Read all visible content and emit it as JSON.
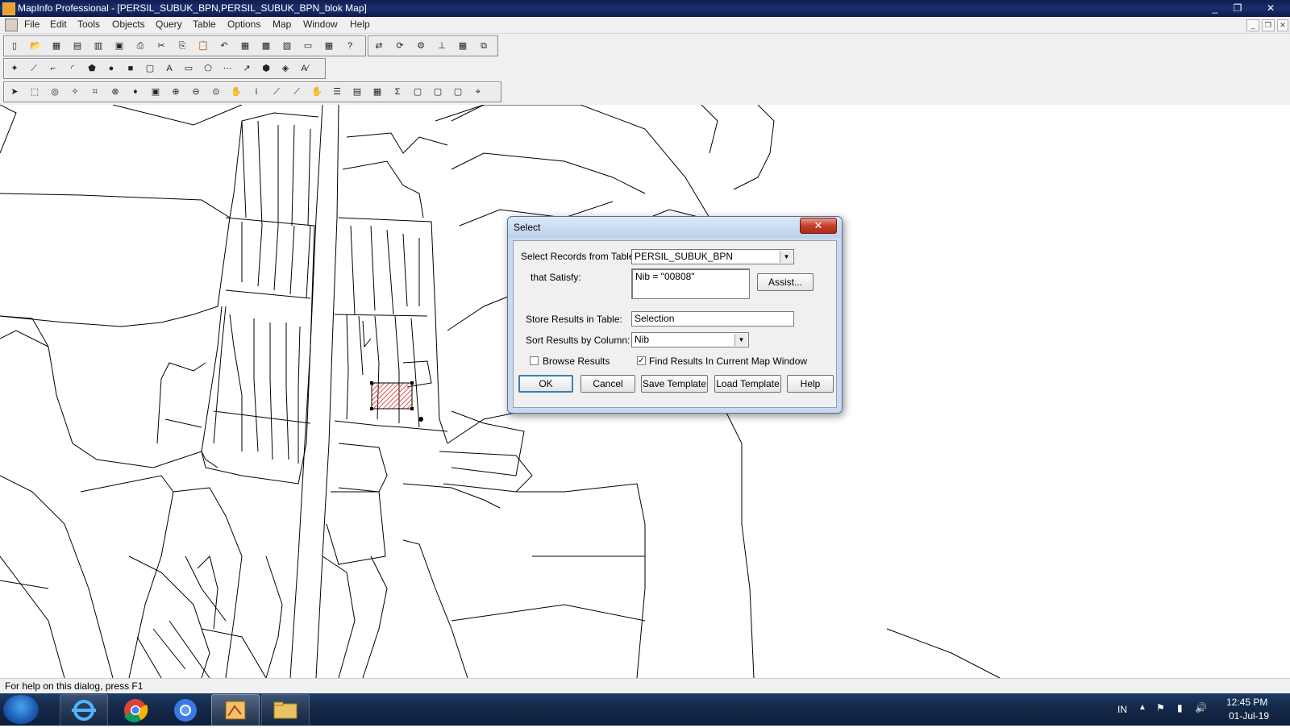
{
  "window": {
    "title": "MapInfo Professional - [PERSIL_SUBUK_BPN,PERSIL_SUBUK_BPN_blok Map]",
    "controls": [
      "_",
      "❐",
      "✕"
    ]
  },
  "menu": {
    "items": [
      "File",
      "Edit",
      "Tools",
      "Objects",
      "Query",
      "Table",
      "Options",
      "Map",
      "Window",
      "Help"
    ],
    "mdi_controls": [
      "_",
      "❐",
      "✕"
    ]
  },
  "toolbars": {
    "standard": [
      "new-icon",
      "open-icon",
      "open-workspace-icon",
      "save-icon",
      "save-workspace-icon",
      "print-preview-icon",
      "print-icon",
      "cut-icon",
      "copy-icon",
      "paste-icon",
      "undo-icon",
      "new-browser-icon",
      "new-mapper-icon",
      "new-grapher-icon",
      "new-layout-icon",
      "redistrict-icon",
      "help-icon"
    ],
    "standard_tail": [
      "hotlink-icon",
      "run-mapbasic-icon",
      "tool-manager-icon",
      "statistics-icon",
      "color-icon",
      "window-icon"
    ],
    "drawing": [
      "symbol-icon",
      "line-icon",
      "polyline-icon",
      "arc-icon",
      "polygon-icon",
      "ellipse-icon",
      "rectangle-icon",
      "rounded-rect-icon",
      "text-icon",
      "frame-icon",
      "reshape-icon",
      "add-node-icon",
      "line-style-icon",
      "region-style-icon",
      "symbol-style-icon",
      "text-style-icon"
    ],
    "main": [
      "select-icon",
      "marquee-select-icon",
      "radius-select-icon",
      "polygon-select-icon",
      "boundary-select-icon",
      "unselect-all-icon",
      "invert-selection-icon",
      "graph-select-icon",
      "zoom-in-icon",
      "zoom-out-icon",
      "change-view-icon",
      "grabber-icon",
      "info-icon",
      "hotlink-tool-icon",
      "ruler-icon",
      "drag-map-icon",
      "layer-control-icon",
      "label-icon",
      "legend-icon",
      "statistics-sum-icon",
      "clip-region-icon",
      "set-clip-icon",
      "drag-window-icon",
      "layout-tool-icon"
    ],
    "drawing_glyphs": [
      "✦",
      "⟋",
      "⌐",
      "◜",
      "⬟",
      "●",
      "■",
      "▢",
      "A",
      "▭",
      "⬠",
      "⋯",
      "↗",
      "⬢",
      "◈",
      "A⁄"
    ],
    "main_glyphs": [
      "➤",
      "⬚",
      "◎",
      "✧",
      "⌗",
      "⊗",
      "➧",
      "▣",
      "⊕",
      "⊖",
      "⊙",
      "✋",
      "i",
      "⟋",
      "⟋",
      "✋",
      "☰",
      "▤",
      "▦",
      "Σ",
      "▢",
      "▢",
      "▢",
      "⌖"
    ],
    "standard_glyphs": [
      "▯",
      "📂",
      "▦",
      "▤",
      "▥",
      "▣",
      "⎙",
      "✂",
      "⎘",
      "📋",
      "↶",
      "▦",
      "▩",
      "▧",
      "▭",
      "▦",
      "?"
    ],
    "standard_tail_glyphs": [
      "⇄",
      "⟳",
      "⚙",
      "⊥",
      "▦",
      "⧉"
    ]
  },
  "status_bar": {
    "text": "For help on this dialog, press F1"
  },
  "dialog": {
    "title": "Select",
    "close_label": "✕",
    "select_records_label": "Select Records from Table:",
    "table_value": "PERSIL_SUBUK_BPN",
    "that_satisfy_label": "that Satisfy:",
    "expression_value": "Nib = \"00808\"",
    "assist_label": "Assist...",
    "store_results_label": "Store Results in Table:",
    "store_value": "Selection",
    "sort_results_label": "Sort Results by Column:",
    "sort_value": "Nib",
    "browse_results_label": "Browse Results",
    "browse_results_checked": false,
    "find_results_label": "Find Results In Current Map Window",
    "find_results_checked": true,
    "buttons": {
      "ok": "OK",
      "cancel": "Cancel",
      "save_template": "Save Template",
      "load_template": "Load Template",
      "help": "Help"
    },
    "checkmark": "✓",
    "dropdown_arrow": "▼"
  },
  "taskbar": {
    "language": "IN",
    "time": "12:45 PM",
    "date": "01-Jul-19",
    "apps": [
      "internet-explorer",
      "chrome",
      "chromium",
      "mapinfo",
      "file-explorer"
    ],
    "tray_glyphs": [
      "▲",
      "⚑",
      "▮",
      "🔊"
    ]
  },
  "colors": {
    "title_bar": "#0f1e52",
    "dialog_frame": "#c9d9ee",
    "selected_parcel": "#e05050",
    "taskbar": "#14294a"
  }
}
